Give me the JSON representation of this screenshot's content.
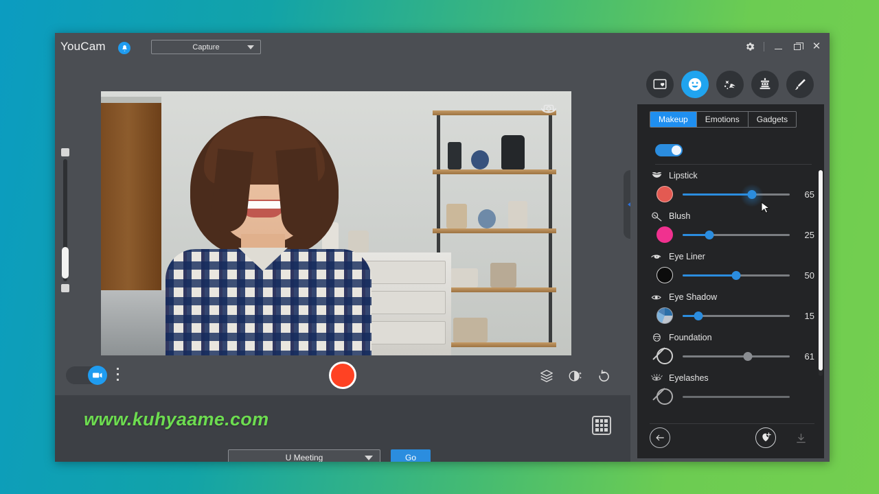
{
  "app": {
    "brand": "YouCam",
    "notification_icon": "bell-icon",
    "capture_mode": "Capture",
    "window_controls": [
      "gear-icon",
      "minimize-icon",
      "maximize-icon",
      "close-icon"
    ]
  },
  "stage": {
    "flip_camera_icon": "camera-rotate-icon",
    "zoom_slider": {
      "top_cap": "zoom-in-handle",
      "bottom_cap": "zoom-out-handle",
      "value": 18
    },
    "collapse_tab_icon": "chevron-left-icon"
  },
  "controlbar": {
    "camera_toggle": {
      "state": "on",
      "icon": "video-camera-icon"
    },
    "more_options_icon": "kebab-menu-icon",
    "record_button": "record-button",
    "right_icons": [
      {
        "name": "layers-icon",
        "label": "Layers"
      },
      {
        "name": "beautify-icon",
        "label": "Beautify"
      },
      {
        "name": "reset-icon",
        "label": "Reset"
      }
    ]
  },
  "bottom": {
    "watermark": "www.kuhyaame.com",
    "grid_icon": "grid-view-icon",
    "meeting_select": "U Meeting",
    "go_label": "Go"
  },
  "panel": {
    "effect_tabs": [
      {
        "name": "scene-icon",
        "active": false
      },
      {
        "name": "face-smile-icon",
        "active": true
      },
      {
        "name": "particles-icon",
        "active": false
      },
      {
        "name": "avatar-mask-icon",
        "active": false
      },
      {
        "name": "pen-tool-icon",
        "active": false
      }
    ],
    "segments": [
      {
        "label": "Makeup",
        "active": true
      },
      {
        "label": "Emotions",
        "active": false
      },
      {
        "label": "Gadgets",
        "active": false
      }
    ],
    "master_toggle": "on",
    "sliders": [
      {
        "label": "Lipstick",
        "icon": "lips-icon",
        "value": 65,
        "swatch": "#e35a52",
        "fill": true,
        "handle": "#2b8ddf",
        "highlight": true
      },
      {
        "label": "Blush",
        "icon": "blush-icon",
        "value": 25,
        "swatch": "#f0318f",
        "fill": true,
        "handle": "#2b8ddf",
        "highlight": false
      },
      {
        "label": "Eye Liner",
        "icon": "eyeliner-icon",
        "value": 50,
        "swatch": "#0c0c0c",
        "fill": true,
        "handle": "#2b8ddf",
        "highlight": false
      },
      {
        "label": "Eye Shadow",
        "icon": "eyeshadow-icon",
        "value": 15,
        "swatch": "multi",
        "fill": true,
        "handle": "#2b8ddf",
        "highlight": false
      },
      {
        "label": "Foundation",
        "icon": "foundation-icon",
        "value": 61,
        "swatch": "none",
        "fill": false,
        "handle": "#8a8d91",
        "highlight": false
      },
      {
        "label": "Eyelashes",
        "icon": "eyelashes-icon",
        "value": 0,
        "swatch": "none",
        "fill": false,
        "handle": "#8a8d91",
        "highlight": false
      }
    ],
    "footer": {
      "back_icon": "arrow-left-icon",
      "add_preset_icon": "add-preset-icon",
      "download_icon": "download-icon"
    }
  },
  "theme": {
    "accent": "#2b8ddf",
    "active_tab": "#1f8ff0",
    "record": "#ff4223",
    "watermark_color": "#6ddc50",
    "panel_bg": "#232426",
    "chrome_bg": "#4b4e53"
  }
}
